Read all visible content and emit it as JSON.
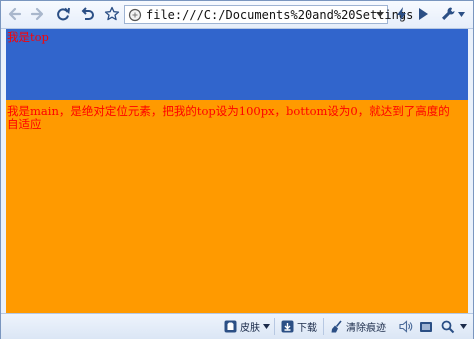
{
  "toolbar": {
    "url": "file:///C:/Documents%20and%20Settings"
  },
  "page": {
    "top_text": "我是top",
    "main_text": "我是main，是绝对定位元素，把我的top设为100px，bottom设为0，就达到了高度的自适应"
  },
  "statusbar": {
    "skin_label": "皮肤",
    "download_label": "下载",
    "clear_traces_label": "清除痕迹"
  },
  "colors": {
    "top_block": "#3165cc",
    "main_block": "#ff9a00",
    "text": "#ff0000"
  }
}
